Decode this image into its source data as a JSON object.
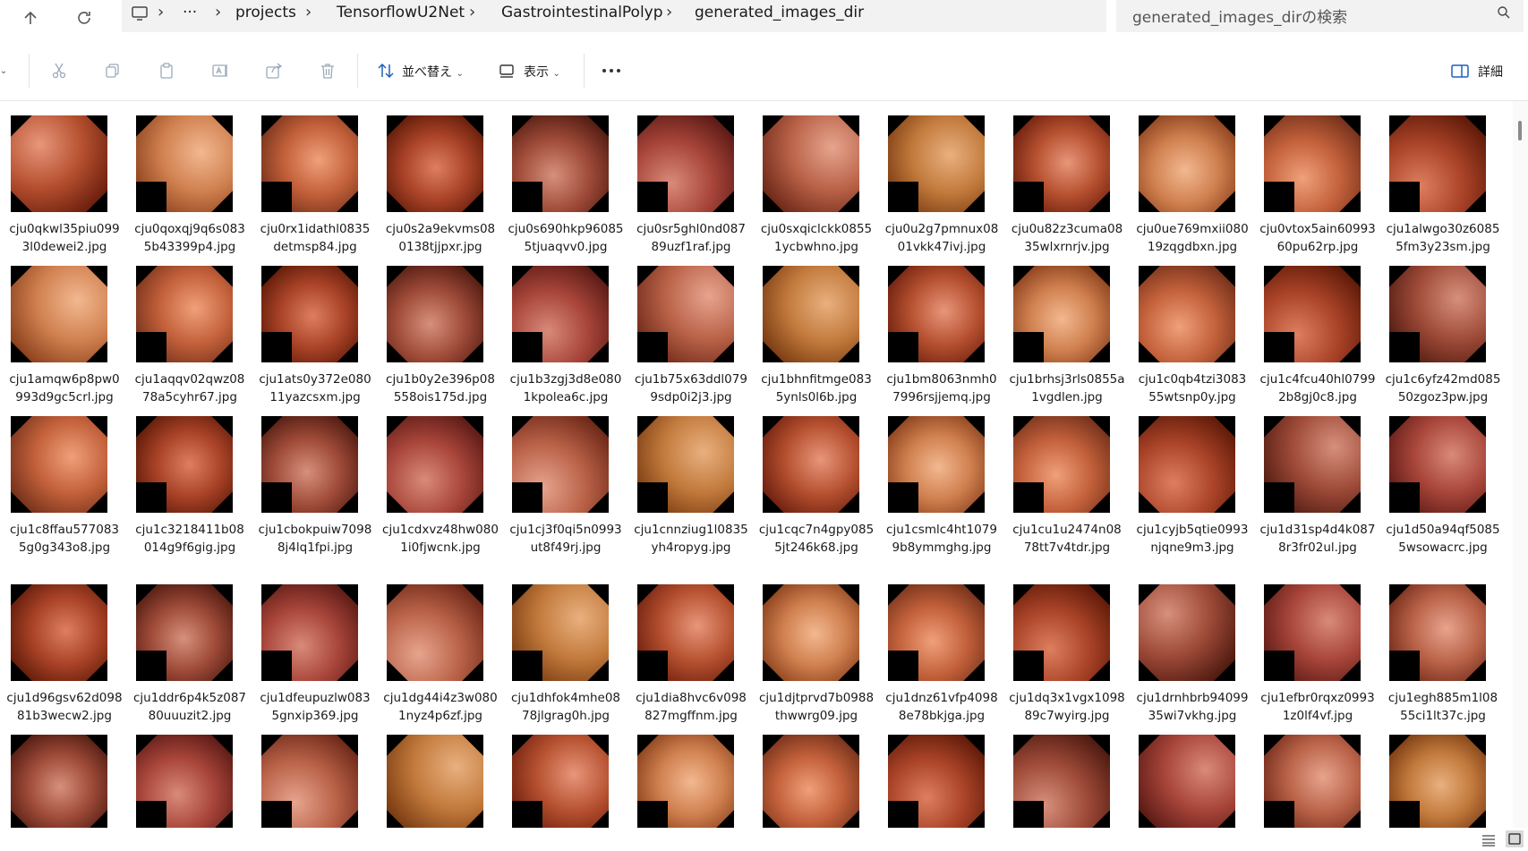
{
  "address": {
    "crumbs": [
      "projects",
      "TensorflowU2Net",
      "GastrointestinalPolyp",
      "generated_images_dir"
    ],
    "search_placeholder": "generated_images_dirの検索"
  },
  "toolbar": {
    "sort_label": "並べ替え",
    "view_label": "表示",
    "details_label": "詳細"
  },
  "files": [
    "cju0qkwl35piu0993l0dewei2.jpg",
    "cju0qoxqj9q6s0835b43399p4.jpg",
    "cju0rx1idathl0835detmsp84.jpg",
    "cju0s2a9ekvms080138tjjpxr.jpg",
    "cju0s690hkp960855tjuaqvv0.jpg",
    "cju0sr5ghl0nd08789uzf1raf.jpg",
    "cju0sxqiclckk08551ycbwhno.jpg",
    "cju0u2g7pmnux0801vkk47ivj.jpg",
    "cju0u82z3cuma0835wlxrnrjv.jpg",
    "cju0ue769mxii08019zqgdbxn.jpg",
    "cju0vtox5ain6099360pu62rp.jpg",
    "cju1alwgo30z60855fm3y23sm.jpg",
    "cju1amqw6p8pw0993d9gc5crl.jpg",
    "cju1aqqv02qwz0878a5cyhr67.jpg",
    "cju1ats0y372e08011yazcsxm.jpg",
    "cju1b0y2e396p08558ois175d.jpg",
    "cju1b3zgj3d8e0801kpolea6c.jpg",
    "cju1b75x63ddl0799sdp0i2j3.jpg",
    "cju1bhnfitmge0835ynls0l6b.jpg",
    "cju1bm8063nmh07996rsjjemq.jpg",
    "cju1brhsj3rls0855a1vgdlen.jpg",
    "cju1c0qb4tzi3083 55wtsnp0y.jpg",
    "cju1c4fcu40hl07992b8gj0c8.jpg",
    "cju1c6yfz42md08550zgoz3pw.jpg",
    "cju1c8ffau5770835g0g343o8.jpg",
    "cju1c3218411b08014g9f6gig.jpg",
    "cju1cbokpuiw70988j4lq1fpi.jpg",
    "cju1cdxvz48hw0801i0fjwcnk.jpg",
    "cju1cj3f0qi5n0993ut8f49rj.jpg",
    "cju1cnnziug1l0835yh4ropyg.jpg",
    "cju1cqc7n4gpy0855jt246k68.jpg",
    "cju1csmlc4ht10799b8ymmghg.jpg",
    "cju1cu1u2474n0878tt7v4tdr.jpg",
    "cju1cyjb5qtie0993njqne9m3.jpg",
    "cju1d31sp4d4k0878r3fr02ul.jpg",
    "cju1d50a94qf50855wsowacrc.jpg",
    "cju1d96gsv62d09881b3wecw2.jpg",
    "cju1ddr6p4k5z08780uuuzit2.jpg",
    "cju1dfeupuzlw0835gnxip369.jpg",
    "cju1dg44i4z3w0801nyz4p6zf.jpg",
    "cju1dhfok4mhe0878jlgrag0h.jpg",
    "cju1dia8hvc6v098827mgffnm.jpg",
    "cju1djtprvd7b0988thwwrg09.jpg",
    "cju1dnz61vfp40988e78bkjga.jpg",
    "cju1dq3x1vgx109889c7wyirg.jpg",
    "cju1drnhbrb9409935wi7vkhg.jpg",
    "cju1efbr0rqxz09931z0lf4vf.jpg",
    "cju1egh885m1l0855ci1lt37c.jpg",
    "",
    "",
    "",
    "",
    "",
    "",
    "",
    "",
    "",
    "",
    "",
    ""
  ]
}
